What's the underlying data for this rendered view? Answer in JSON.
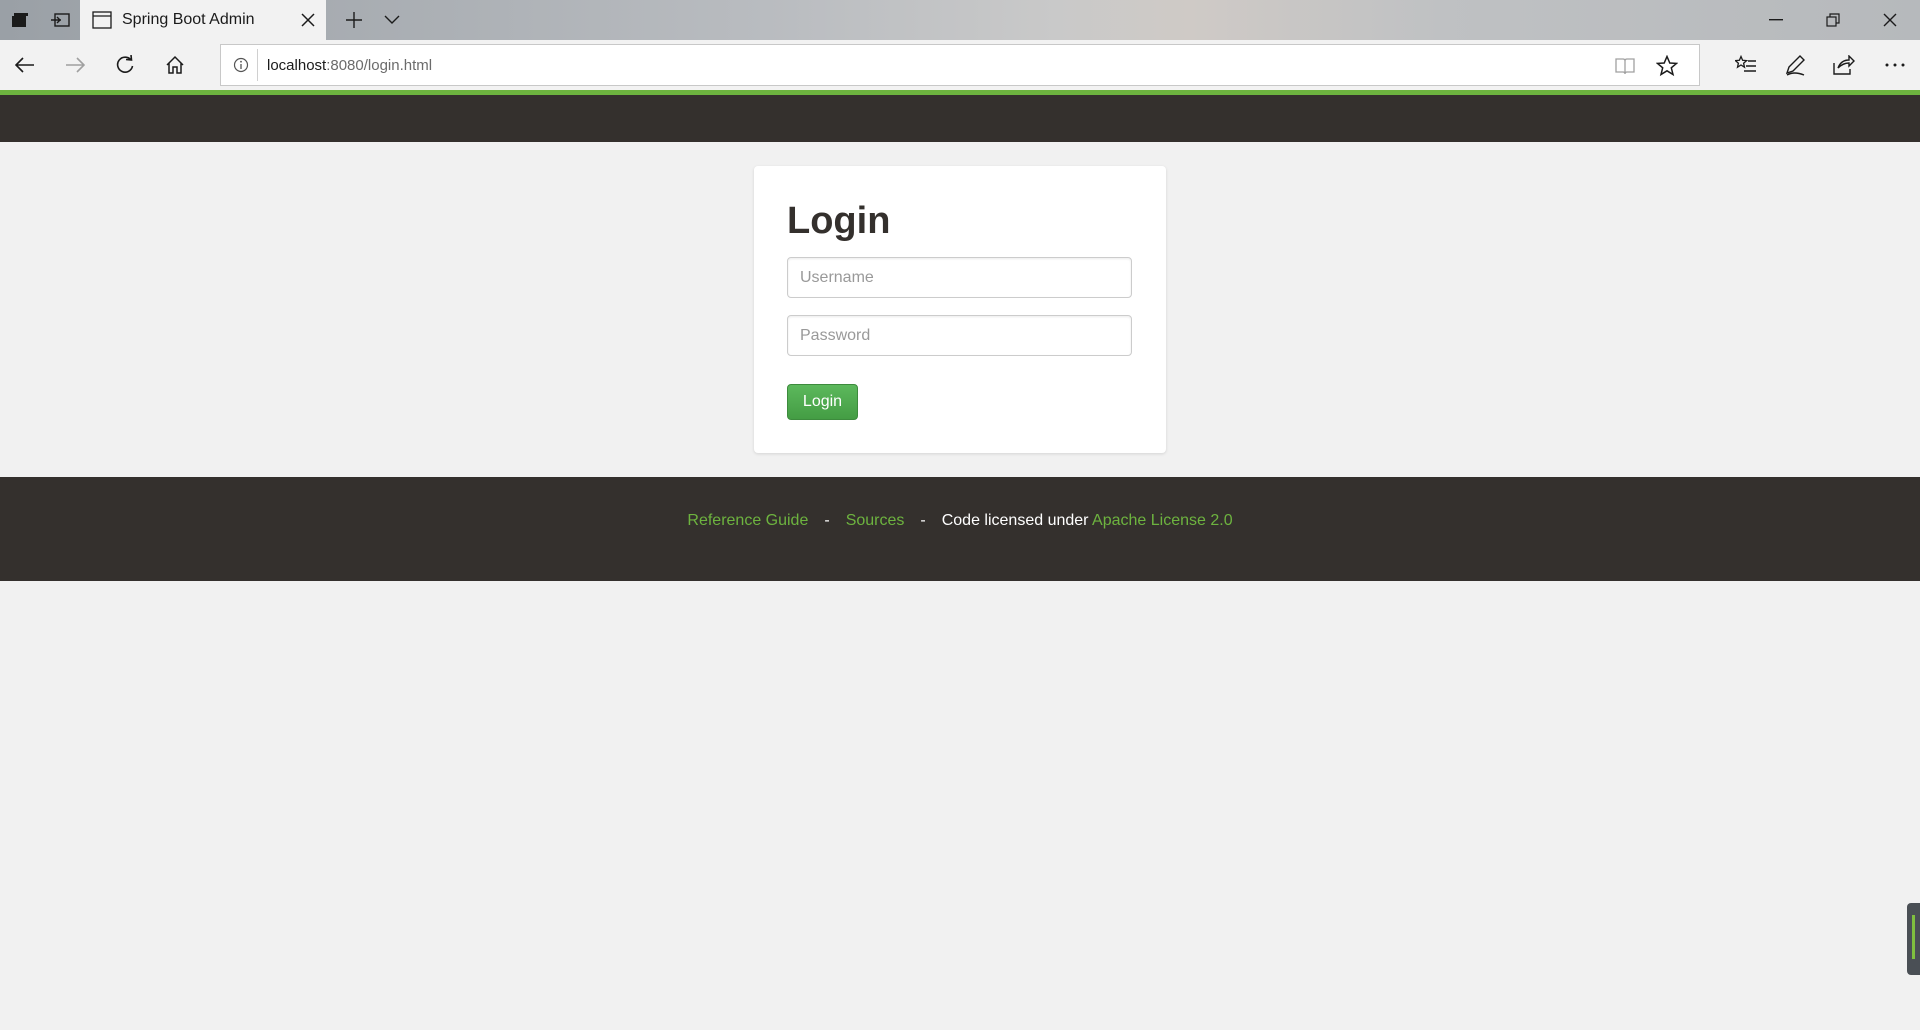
{
  "browser": {
    "tab_title": "Spring Boot Admin",
    "address_host": "localhost",
    "address_path": ":8080/login.html"
  },
  "login": {
    "heading": "Login",
    "username_placeholder": "Username",
    "password_placeholder": "Password",
    "button_label": "Login"
  },
  "footer": {
    "reference_guide": "Reference Guide",
    "sources": "Sources",
    "separator": "-",
    "license_prefix": "Code licensed under",
    "license_link": "Apache License 2.0"
  },
  "colors": {
    "accent": "#6db33f",
    "header_dark": "#34302d",
    "button_green": "#5cb85c"
  }
}
